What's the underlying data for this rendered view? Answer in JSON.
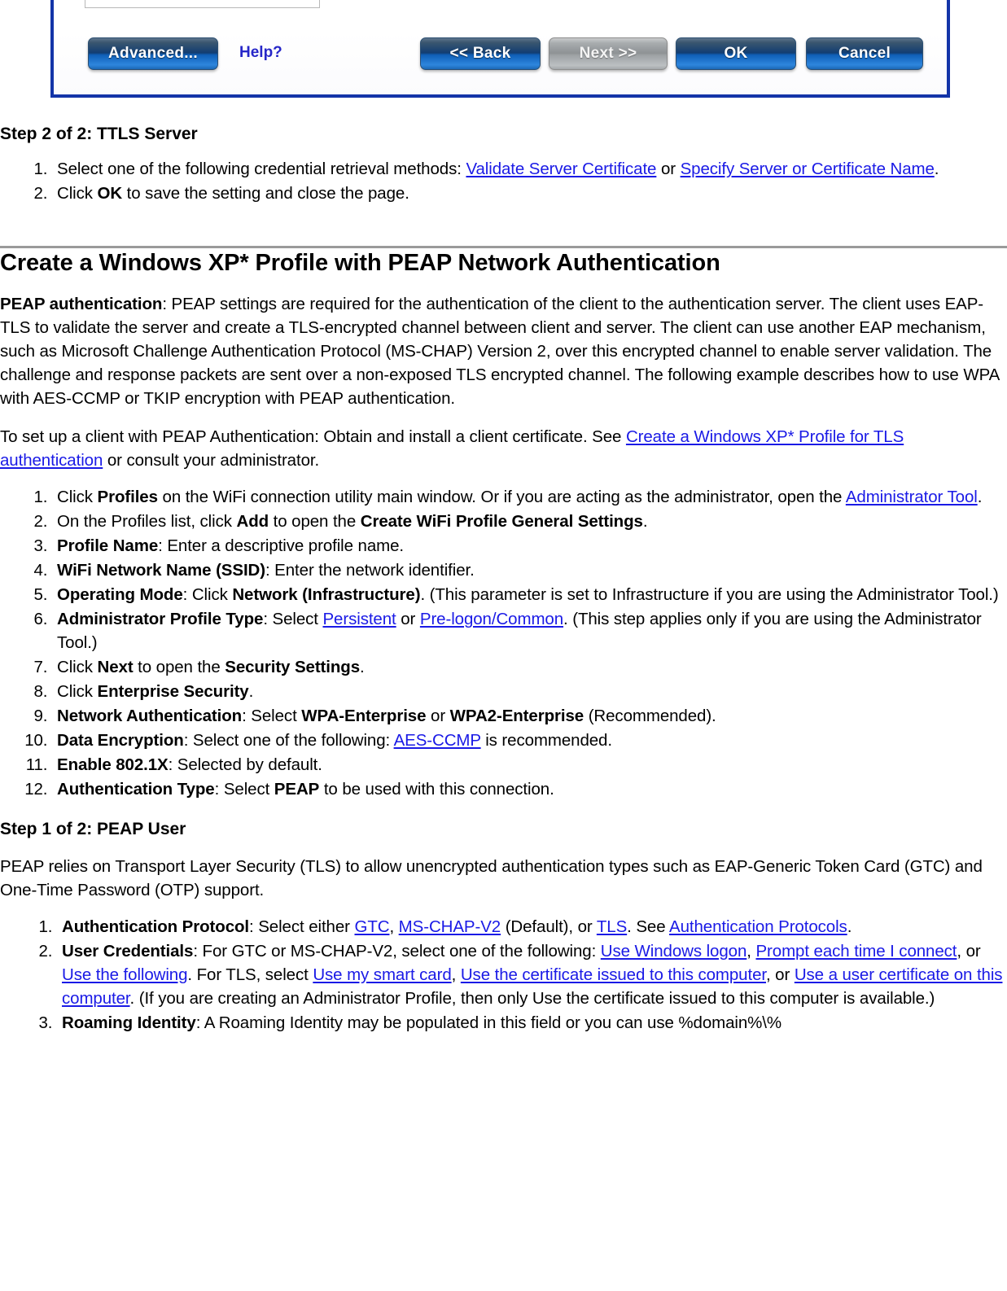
{
  "dialog": {
    "name": "wifi-profile-dialog-fragment",
    "buttons": {
      "advanced": "Advanced...",
      "help": "Help?",
      "back": "<< Back",
      "next": "Next >>",
      "ok": "OK",
      "cancel": "Cancel"
    },
    "next_disabled": true,
    "border_color": "#1334a8",
    "button_accent": "#0f5fb7"
  },
  "section_ttls": {
    "heading": "Step 2 of 2: TTLS Server",
    "items": [
      {
        "n": "1.",
        "parts": [
          {
            "t": "text",
            "v": "Select one of the following credential retrieval methods: "
          },
          {
            "t": "link",
            "v": "Validate Server Certificate"
          },
          {
            "t": "text",
            "v": " or "
          },
          {
            "t": "link",
            "v": "Specify Server or Certificate Name"
          },
          {
            "t": "text",
            "v": "."
          }
        ]
      },
      {
        "n": "2.",
        "parts": [
          {
            "t": "text",
            "v": "Click "
          },
          {
            "t": "bold",
            "v": "OK"
          },
          {
            "t": "text",
            "v": " to save the setting and close the page."
          }
        ]
      }
    ]
  },
  "main": {
    "heading": "Create a Windows XP* Profile with PEAP Network Authentication",
    "intro_label": "PEAP authentication",
    "intro_body": ": PEAP settings are required for the authentication of the client to the authentication server. The client uses EAP-TLS to validate the server and create a TLS-encrypted channel between client and server. The client can use another EAP mechanism, such as Microsoft Challenge Authentication Protocol (MS-CHAP) Version 2, over this encrypted channel to enable server validation. The challenge and response packets are sent over a non-exposed TLS encrypted channel. The following example describes how to use WPA with AES-CCMP or TKIP encryption with PEAP authentication.",
    "setup_pre": "To set up a client with PEAP Authentication: Obtain and install a client certificate. See ",
    "setup_link": "Create a Windows XP* Profile for TLS authentication",
    "setup_post": " or consult your administrator."
  },
  "profile_steps": [
    {
      "n": "1.",
      "parts": [
        {
          "t": "text",
          "v": "Click "
        },
        {
          "t": "bold",
          "v": "Profiles"
        },
        {
          "t": "text",
          "v": " on the WiFi connection utility main window. Or if you are acting as the administrator, open the "
        },
        {
          "t": "link",
          "v": "Administrator Tool"
        },
        {
          "t": "text",
          "v": "."
        }
      ]
    },
    {
      "n": "2.",
      "parts": [
        {
          "t": "text",
          "v": "On the Profiles list, click "
        },
        {
          "t": "bold",
          "v": "Add"
        },
        {
          "t": "text",
          "v": " to open the "
        },
        {
          "t": "bold",
          "v": "Create WiFi Profile General Settings"
        },
        {
          "t": "text",
          "v": "."
        }
      ]
    },
    {
      "n": "3.",
      "parts": [
        {
          "t": "bolditalic",
          "v": "Profile Name"
        },
        {
          "t": "text",
          "v": ": Enter a descriptive profile name."
        }
      ]
    },
    {
      "n": "4.",
      "parts": [
        {
          "t": "bolditalic",
          "v": "WiFi Network Name (SSID)"
        },
        {
          "t": "text",
          "v": ": Enter the network identifier."
        }
      ]
    },
    {
      "n": "5.",
      "parts": [
        {
          "t": "bolditalic",
          "v": "Operating Mode"
        },
        {
          "t": "text",
          "v": ": Click "
        },
        {
          "t": "bold",
          "v": "Network (Infrastructure)"
        },
        {
          "t": "text",
          "v": ". (This parameter is set to Infrastructure if you are using the Administrator Tool.)"
        }
      ]
    },
    {
      "n": "6.",
      "parts": [
        {
          "t": "bolditalic",
          "v": "Administrator Profile Type"
        },
        {
          "t": "text",
          "v": ": Select "
        },
        {
          "t": "link",
          "v": "Persistent"
        },
        {
          "t": "text",
          "v": " or "
        },
        {
          "t": "link",
          "v": "Pre-logon/Common"
        },
        {
          "t": "text",
          "v": ". (This step applies only if you are using the Administrator Tool.)"
        }
      ]
    },
    {
      "n": "7.",
      "parts": [
        {
          "t": "text",
          "v": "Click "
        },
        {
          "t": "bold",
          "v": "Next"
        },
        {
          "t": "text",
          "v": " to open the "
        },
        {
          "t": "bold",
          "v": "Security Settings"
        },
        {
          "t": "text",
          "v": "."
        }
      ]
    },
    {
      "n": "8.",
      "parts": [
        {
          "t": "text",
          "v": "Click "
        },
        {
          "t": "bold",
          "v": "Enterprise Security"
        },
        {
          "t": "text",
          "v": "."
        }
      ]
    },
    {
      "n": "9.",
      "parts": [
        {
          "t": "bolditalic",
          "v": "Network Authentication"
        },
        {
          "t": "text",
          "v": ": Select "
        },
        {
          "t": "bold",
          "v": "WPA-Enterprise"
        },
        {
          "t": "text",
          "v": " or "
        },
        {
          "t": "bold",
          "v": "WPA2-Enterprise"
        },
        {
          "t": "text",
          "v": " (Recommended)."
        }
      ]
    },
    {
      "n": "10.",
      "parts": [
        {
          "t": "bolditalic",
          "v": "Data Encryption"
        },
        {
          "t": "text",
          "v": ": Select one of the following: "
        },
        {
          "t": "link",
          "v": "AES-CCMP"
        },
        {
          "t": "text",
          "v": " is recommended."
        }
      ]
    },
    {
      "n": "11.",
      "parts": [
        {
          "t": "bolditalic",
          "v": "Enable 802.1X"
        },
        {
          "t": "text",
          "v": ": Selected by default."
        }
      ]
    },
    {
      "n": "12.",
      "parts": [
        {
          "t": "bolditalic",
          "v": "Authentication Type"
        },
        {
          "t": "text",
          "v": ": Select "
        },
        {
          "t": "bold",
          "v": "PEAP"
        },
        {
          "t": "text",
          "v": " to be used with this connection."
        }
      ]
    }
  ],
  "section_peap": {
    "heading": "Step 1 of 2: PEAP User",
    "paragraph": "PEAP relies on Transport Layer Security (TLS) to allow unencrypted authentication types such as EAP-Generic Token Card (GTC) and One-Time Password (OTP) support.",
    "items": [
      {
        "n": "1.",
        "parts": [
          {
            "t": "bolditalic",
            "v": "Authentication Protocol"
          },
          {
            "t": "text",
            "v": ": Select either "
          },
          {
            "t": "link",
            "v": "GTC"
          },
          {
            "t": "text",
            "v": ", "
          },
          {
            "t": "link",
            "v": "MS-CHAP-V2"
          },
          {
            "t": "text",
            "v": " (Default), or "
          },
          {
            "t": "link",
            "v": "TLS"
          },
          {
            "t": "text",
            "v": ". See "
          },
          {
            "t": "link",
            "v": "Authentication Protocols"
          },
          {
            "t": "text",
            "v": "."
          }
        ]
      },
      {
        "n": "2.",
        "parts": [
          {
            "t": "bolditalic",
            "v": "User Credentials"
          },
          {
            "t": "text",
            "v": ": For GTC or MS-CHAP-V2, select one of the following: "
          },
          {
            "t": "link",
            "v": "Use Windows logon"
          },
          {
            "t": "text",
            "v": ", "
          },
          {
            "t": "link",
            "v": "Prompt each time I connect"
          },
          {
            "t": "text",
            "v": ", or "
          },
          {
            "t": "link",
            "v": "Use the following"
          },
          {
            "t": "text",
            "v": ". For TLS, select "
          },
          {
            "t": "link",
            "v": "Use my smart card"
          },
          {
            "t": "text",
            "v": ", "
          },
          {
            "t": "link",
            "v": "Use the certificate issued to this computer"
          },
          {
            "t": "text",
            "v": ", or "
          },
          {
            "t": "link",
            "v": "Use a user certificate on this computer"
          },
          {
            "t": "text",
            "v": ". (If you are creating an Administrator Profile, then only Use the certificate issued to this computer is available.)"
          }
        ]
      },
      {
        "n": "3.",
        "parts": [
          {
            "t": "bolditalic",
            "v": "Roaming Identity"
          },
          {
            "t": "text",
            "v": ": A Roaming Identity may be populated in this field or you can use %domain%\\%"
          }
        ]
      }
    ]
  }
}
